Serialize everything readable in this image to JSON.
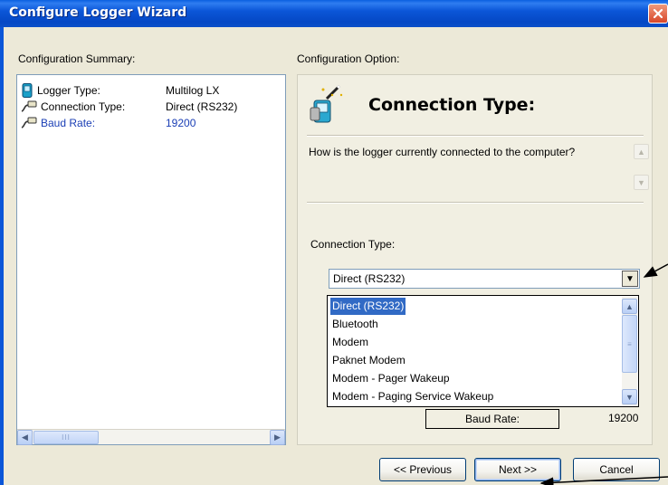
{
  "window": {
    "title": "Configure Logger Wizard"
  },
  "summary": {
    "heading": "Configuration Summary:",
    "rows": [
      {
        "key": "Logger Type:",
        "value": "Multilog LX",
        "icon": "logger-icon"
      },
      {
        "key": "Connection Type:",
        "value": "Direct (RS232)",
        "icon": "cable-icon"
      },
      {
        "key": "Baud Rate:",
        "value": "19200",
        "icon": "cable-icon",
        "selected": true
      }
    ],
    "scroll_thumb_grip": "III"
  },
  "option": {
    "heading": "Configuration Option:",
    "title": "Connection Type:",
    "question": "How is the logger currently connected to the computer?",
    "field_label": "Connection Type:",
    "selected_value": "Direct (RS232)",
    "options": [
      "Direct (RS232)",
      "Bluetooth",
      "Modem",
      "Paknet Modem",
      "Modem - Pager Wakeup",
      "Modem - Paging Service Wakeup"
    ],
    "baud_label": "Baud Rate:",
    "baud_value": "19200"
  },
  "buttons": {
    "previous": "<< Previous",
    "next": "Next >>",
    "cancel": "Cancel"
  },
  "colors": {
    "title_bar": "#0B56D8",
    "selection": "#316AC5",
    "dialog_bg": "#ECE9D8",
    "selected_text": "#1a3eb5"
  }
}
